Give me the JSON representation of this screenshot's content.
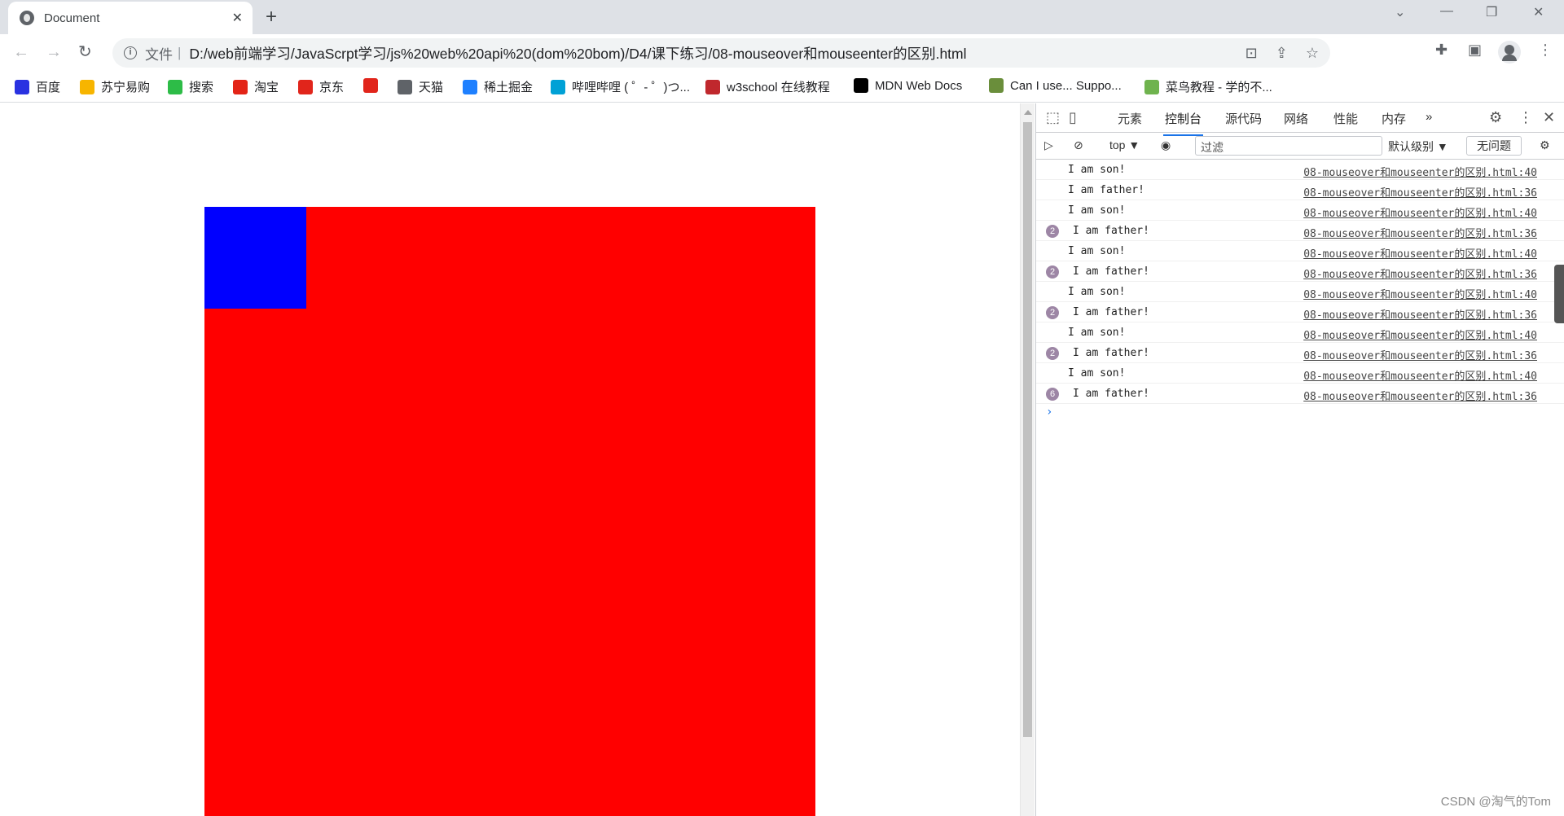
{
  "browser": {
    "tab": {
      "title": "Document",
      "close": "✕"
    },
    "new_tab": "+",
    "address": {
      "scheme": "文件",
      "separator": "|",
      "url": "D:/web前端学习/JavaScrpt学习/js%20web%20api%20(dom%20bom)/D4/课下练习/08-mouseover和mouseenter的区别.html"
    },
    "bookmarks": [
      {
        "label": "百度",
        "icon": "baidu-icon",
        "color": "#2932e1"
      },
      {
        "label": "苏宁易购",
        "icon": "suning-icon",
        "color": "#f7b500"
      },
      {
        "label": "搜索",
        "icon": "search-icon",
        "color": "#2dbc47"
      },
      {
        "label": "淘宝",
        "icon": "taobao-icon",
        "color": "#e32417"
      },
      {
        "label": "京东",
        "icon": "jd-icon",
        "color": "#e1251b"
      },
      {
        "label": "",
        "icon": "grid-icon",
        "color": "#e1251b"
      },
      {
        "label": "天猫",
        "icon": "globe-icon",
        "color": "#5f6368"
      },
      {
        "label": "稀土掘金",
        "icon": "juejin-icon",
        "color": "#1e80ff"
      },
      {
        "label": "哔哩哔哩 ( ゜- ゜)つ...",
        "icon": "bilibili-icon",
        "color": "#00a1d6"
      },
      {
        "label": "w3school 在线教程",
        "icon": "w3school-icon",
        "color": "#c0282d"
      },
      {
        "label": "MDN Web Docs",
        "icon": "mdn-icon",
        "color": "#000000"
      },
      {
        "label": "Can I use... Suppo...",
        "icon": "caniuse-icon",
        "color": "#6a8e3b"
      },
      {
        "label": "菜鸟教程 - 学的不...",
        "icon": "runoob-icon",
        "color": "#6fb34e"
      }
    ]
  },
  "page": {
    "father_color": "#ff0000",
    "son_color": "#0000ff"
  },
  "devtools": {
    "tabs": [
      "元素",
      "控制台",
      "源代码",
      "网络",
      "性能",
      "内存"
    ],
    "active_tab": "控制台",
    "more": "»",
    "context": "top ▼",
    "filter_placeholder": "过滤",
    "level": "默认级别 ▼",
    "issues": "无问题",
    "console": [
      {
        "badge": "",
        "msg": "I am son!",
        "src": "08-mouseover和mouseenter的区别.html:40"
      },
      {
        "badge": "",
        "msg": "I am father!",
        "src": "08-mouseover和mouseenter的区别.html:36"
      },
      {
        "badge": "",
        "msg": "I am son!",
        "src": "08-mouseover和mouseenter的区别.html:40"
      },
      {
        "badge": "2",
        "msg": "I am father!",
        "src": "08-mouseover和mouseenter的区别.html:36"
      },
      {
        "badge": "",
        "msg": "I am son!",
        "src": "08-mouseover和mouseenter的区别.html:40"
      },
      {
        "badge": "2",
        "msg": "I am father!",
        "src": "08-mouseover和mouseenter的区别.html:36"
      },
      {
        "badge": "",
        "msg": "I am son!",
        "src": "08-mouseover和mouseenter的区别.html:40"
      },
      {
        "badge": "2",
        "msg": "I am father!",
        "src": "08-mouseover和mouseenter的区别.html:36"
      },
      {
        "badge": "",
        "msg": "I am son!",
        "src": "08-mouseover和mouseenter的区别.html:40"
      },
      {
        "badge": "2",
        "msg": "I am father!",
        "src": "08-mouseover和mouseenter的区别.html:36"
      },
      {
        "badge": "",
        "msg": "I am son!",
        "src": "08-mouseover和mouseenter的区别.html:40"
      },
      {
        "badge": "6",
        "msg": "I am father!",
        "src": "08-mouseover和mouseenter的区别.html:36"
      }
    ],
    "prompt": "›"
  },
  "watermark": "CSDN @淘气的Tom"
}
